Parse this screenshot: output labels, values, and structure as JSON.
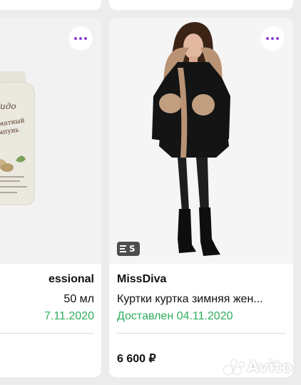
{
  "cards": [
    {
      "title": "essional",
      "description": "50 мл",
      "status": "7.11.2020"
    },
    {
      "title": "MissDiva",
      "description": "Куртки куртка зимняя жен...",
      "status": "Доставлен 04.11.2020",
      "price": "6 600 ₽",
      "badge": "S"
    }
  ],
  "colors": {
    "accent": "#8a3fd4",
    "delivered": "#2fae5c",
    "badge_bg": "#4d4d4d"
  },
  "icons": {
    "more": "more-dots-icon",
    "document": "document-icon"
  },
  "watermark": "Avito"
}
